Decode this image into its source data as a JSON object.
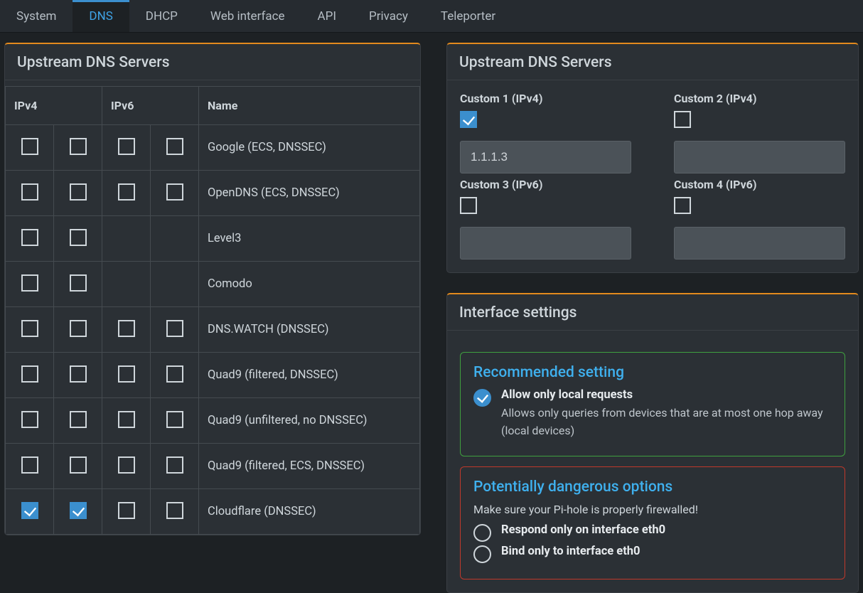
{
  "tabs": [
    {
      "id": "system",
      "label": "System",
      "active": false
    },
    {
      "id": "dns",
      "label": "DNS",
      "active": true
    },
    {
      "id": "dhcp",
      "label": "DHCP",
      "active": false
    },
    {
      "id": "web",
      "label": "Web interface",
      "active": false
    },
    {
      "id": "api",
      "label": "API",
      "active": false
    },
    {
      "id": "privacy",
      "label": "Privacy",
      "active": false
    },
    {
      "id": "teleporter",
      "label": "Teleporter",
      "active": false
    }
  ],
  "left_card_title": "Upstream DNS Servers",
  "table_headers": {
    "ipv4": "IPv4",
    "ipv6": "IPv6",
    "name": "Name"
  },
  "providers": [
    {
      "name": "Google (ECS, DNSSEC)",
      "v4": [
        false,
        false
      ],
      "v6": [
        false,
        false
      ]
    },
    {
      "name": "OpenDNS (ECS, DNSSEC)",
      "v4": [
        false,
        false
      ],
      "v6": [
        false,
        false
      ]
    },
    {
      "name": "Level3",
      "v4": [
        false,
        false
      ],
      "v6": null
    },
    {
      "name": "Comodo",
      "v4": [
        false,
        false
      ],
      "v6": null
    },
    {
      "name": "DNS.WATCH (DNSSEC)",
      "v4": [
        false,
        false
      ],
      "v6": [
        false,
        false
      ]
    },
    {
      "name": "Quad9 (filtered, DNSSEC)",
      "v4": [
        false,
        false
      ],
      "v6": [
        false,
        false
      ]
    },
    {
      "name": "Quad9 (unfiltered, no DNSSEC)",
      "v4": [
        false,
        false
      ],
      "v6": [
        false,
        false
      ]
    },
    {
      "name": "Quad9 (filtered, ECS, DNSSEC)",
      "v4": [
        false,
        false
      ],
      "v6": [
        false,
        false
      ]
    },
    {
      "name": "Cloudflare (DNSSEC)",
      "v4": [
        true,
        true
      ],
      "v6": [
        false,
        false
      ]
    }
  ],
  "right_card_title": "Upstream DNS Servers",
  "custom": [
    {
      "label": "Custom 1 (IPv4)",
      "checked": true,
      "value": "1.1.1.3"
    },
    {
      "label": "Custom 2 (IPv4)",
      "checked": false,
      "value": ""
    },
    {
      "label": "Custom 3 (IPv6)",
      "checked": false,
      "value": ""
    },
    {
      "label": "Custom 4 (IPv6)",
      "checked": false,
      "value": ""
    }
  ],
  "iface_title": "Interface settings",
  "rec_title": "Recommended setting",
  "rec_opt": {
    "title": "Allow only local requests",
    "desc": "Allows only queries from devices that are at most one hop away (local devices)",
    "selected": true
  },
  "danger_title": "Potentially dangerous options",
  "danger_warn": "Make sure your Pi-hole is properly firewalled!",
  "danger_opts": [
    {
      "title": "Respond only on interface eth0",
      "selected": false
    },
    {
      "title": "Bind only to interface eth0",
      "selected": false
    }
  ]
}
